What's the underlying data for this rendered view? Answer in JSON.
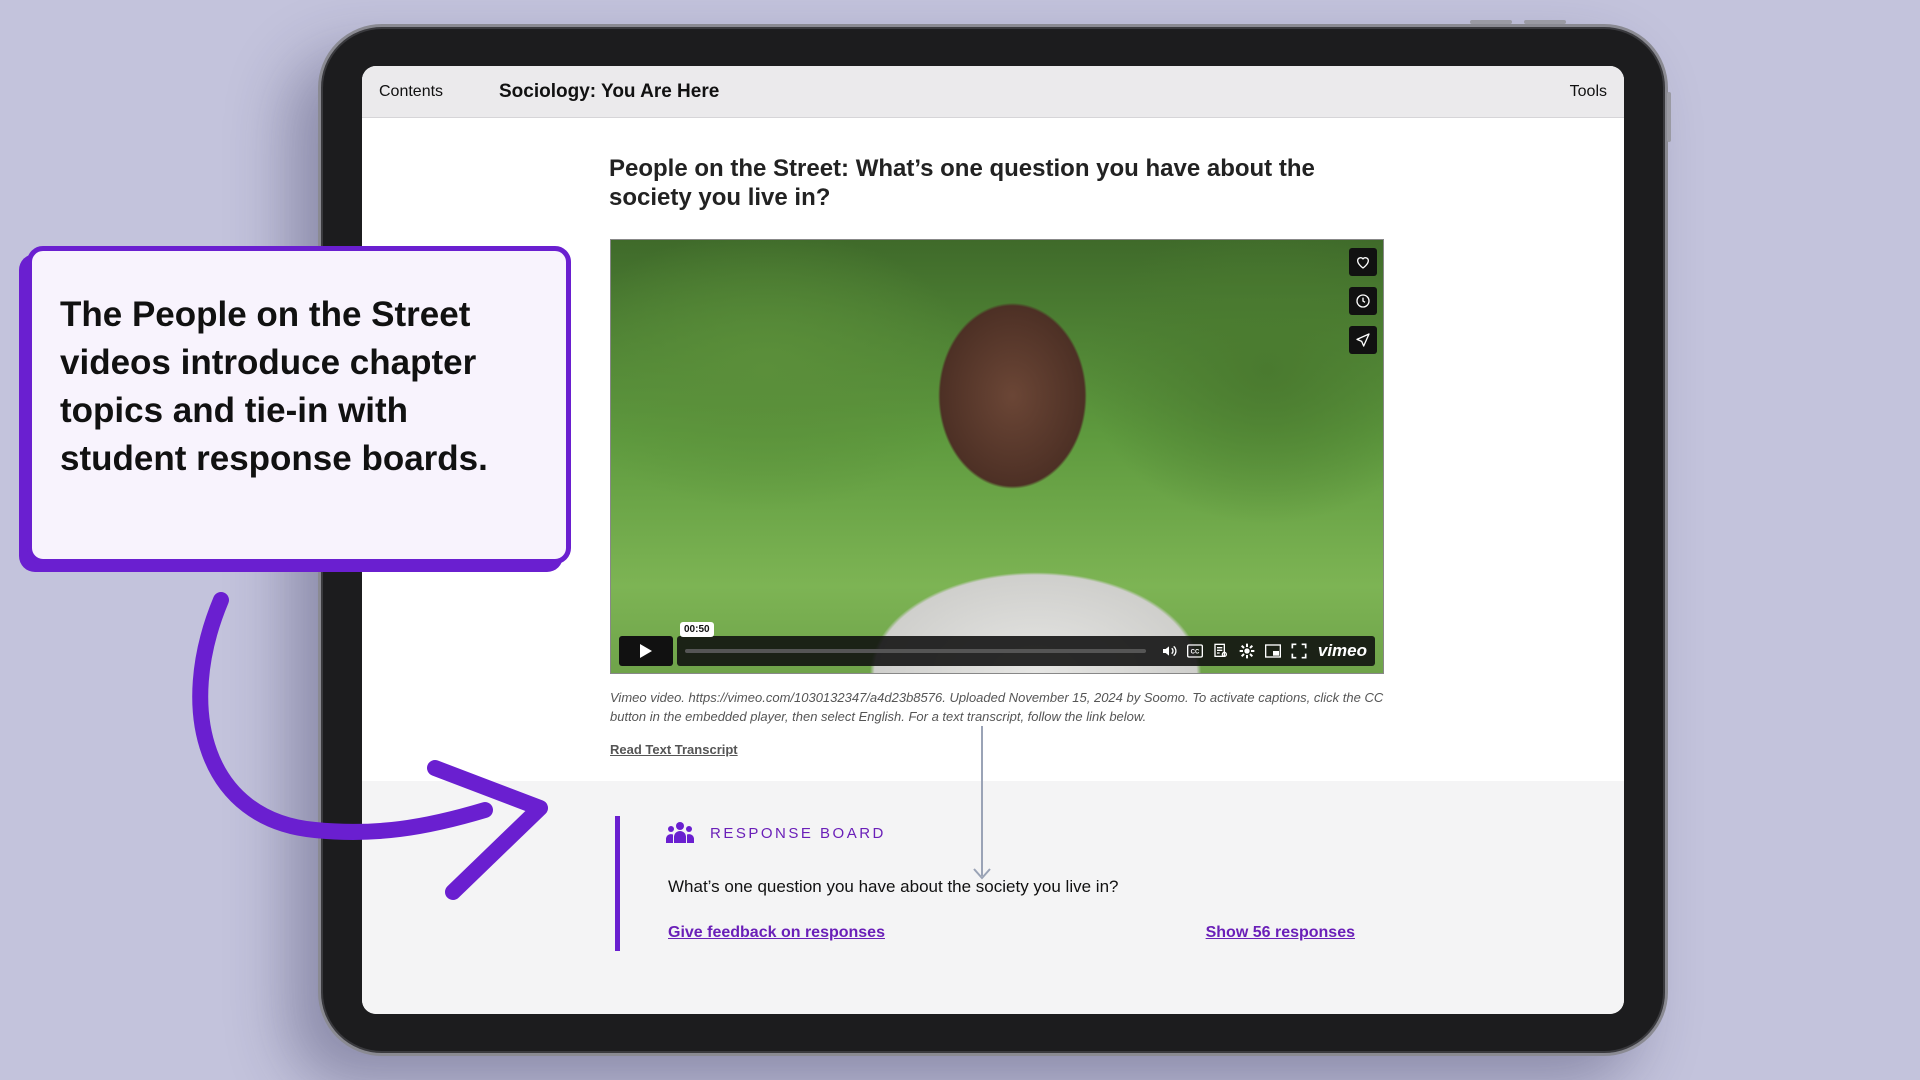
{
  "topbar": {
    "contents_label": "Contents",
    "book_title": "Sociology: You Are Here",
    "tools_label": "Tools"
  },
  "page": {
    "heading": "People on the Street: What’s one question you have about the society you live in?"
  },
  "video": {
    "time_badge": "00:50",
    "brand": "vimeo",
    "caption": "Vimeo video. https://vimeo.com/1030132347/a4d23b8576. Uploaded November 15, 2024 by Soomo. To activate captions, click the CC button in the embedded player, then select English. For a text transcript, follow the link below.",
    "transcript_link": "Read Text Transcript",
    "icons": [
      "heart-icon",
      "clock-icon",
      "send-icon",
      "play-icon",
      "volume-icon",
      "cc-icon",
      "transcript-icon",
      "gear-icon",
      "pip-icon",
      "fullscreen-icon"
    ]
  },
  "response_board": {
    "label": "RESPONSE BOARD",
    "question": "What’s one question you have about the society you live in?",
    "feedback_link": "Give feedback on responses",
    "show_link": "Show 56 responses"
  },
  "callout": {
    "text": "The People on the Street videos introduce chapter topics and tie-in with student response boards."
  },
  "colors": {
    "accent": "#6a1fd0",
    "background": "#c3c3dc"
  }
}
